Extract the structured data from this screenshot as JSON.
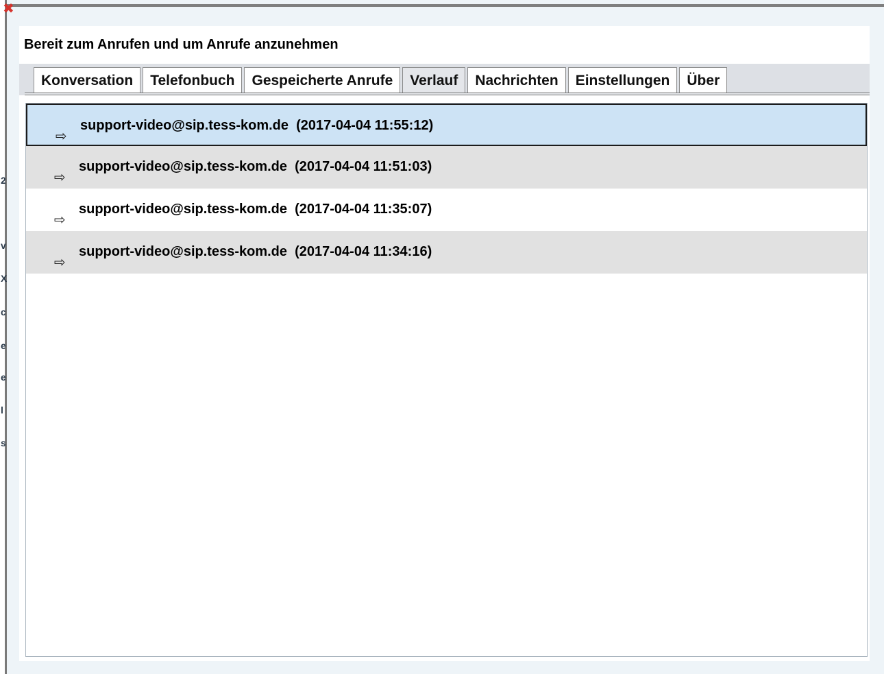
{
  "window": {
    "status": "Bereit zum Anrufen und um Anrufe anzunehmen"
  },
  "backdrop_fragments": [
    "2",
    "v",
    "X",
    "c",
    "e",
    "e",
    "l",
    "s"
  ],
  "tabs": [
    {
      "label": "Konversation",
      "active": false
    },
    {
      "label": "Telefonbuch",
      "active": false
    },
    {
      "label": "Gespeicherte Anrufe",
      "active": false
    },
    {
      "label": "Verlauf",
      "active": true
    },
    {
      "label": "Nachrichten",
      "active": false
    },
    {
      "label": "Einstellungen",
      "active": false
    },
    {
      "label": "Über",
      "active": false
    }
  ],
  "history": [
    {
      "text": "support-video@sip.tess-kom.de  (2017-04-04 11:55:12)",
      "icon": "outgoing-arrow-icon",
      "selected": true
    },
    {
      "text": "support-video@sip.tess-kom.de  (2017-04-04 11:51:03)",
      "icon": "outgoing-arrow-icon",
      "selected": false
    },
    {
      "text": "support-video@sip.tess-kom.de  (2017-04-04 11:35:07)",
      "icon": "outgoing-arrow-icon",
      "selected": false
    },
    {
      "text": "support-video@sip.tess-kom.de  (2017-04-04 11:34:16)",
      "icon": "outgoing-arrow-icon",
      "selected": false
    }
  ],
  "colors": {
    "selected_row": "#cde3f5",
    "alt_row": "#e1e1e1",
    "close_icon": "#d6332c"
  }
}
